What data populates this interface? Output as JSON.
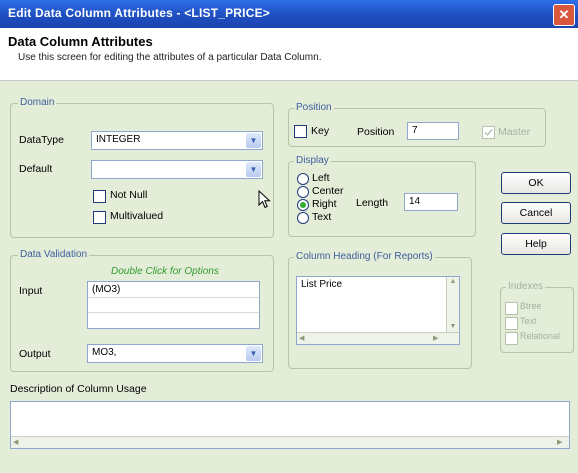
{
  "window": {
    "title": "Edit Data Column Attributes - <LIST_PRICE>",
    "close_glyph": "✕"
  },
  "header": {
    "title": "Data Column Attributes",
    "subtitle": "Use this screen for editing the attributes of a particular Data Column."
  },
  "domain": {
    "group_label": "Domain",
    "datatype_label": "DataType",
    "datatype_value": "INTEGER",
    "default_label": "Default",
    "default_value": "",
    "not_null_label": "Not Null",
    "not_null_checked": false,
    "multivalued_label": "Multivalued",
    "multivalued_checked": false
  },
  "validation": {
    "group_label": "Data Validation",
    "hint": "Double Click for Options",
    "input_label": "Input",
    "input_value": "(MO3)",
    "output_label": "Output",
    "output_value": "MO3,"
  },
  "position": {
    "group_label": "Position",
    "key_label": "Key",
    "key_checked": false,
    "position_label": "Position",
    "position_value": "7",
    "master_label": "Master",
    "master_checked": true
  },
  "display": {
    "group_label": "Display",
    "options": [
      "Left",
      "Center",
      "Right",
      "Text"
    ],
    "selected": "Right",
    "length_label": "Length",
    "length_value": "14"
  },
  "heading": {
    "group_label": "Column Heading (For Reports)",
    "value": "List Price"
  },
  "buttons": {
    "ok": "OK",
    "cancel": "Cancel",
    "help": "Help"
  },
  "indexes": {
    "group_label": "Indexes",
    "items": [
      "Btree",
      "Text",
      "Relational"
    ]
  },
  "description": {
    "label": "Description of Column Usage",
    "value": ""
  },
  "icons": {
    "combo_arrow": "▼",
    "scroll_up": "▲",
    "scroll_down": "▼",
    "scroll_left": "◀",
    "scroll_right": "▶",
    "cursor": "mouse-pointer"
  },
  "colors": {
    "title_bar": "#1f4fc0",
    "panel": "#e3edd8",
    "hint_text": "#2f9b2f",
    "radio_selected": "#2fae2f"
  }
}
